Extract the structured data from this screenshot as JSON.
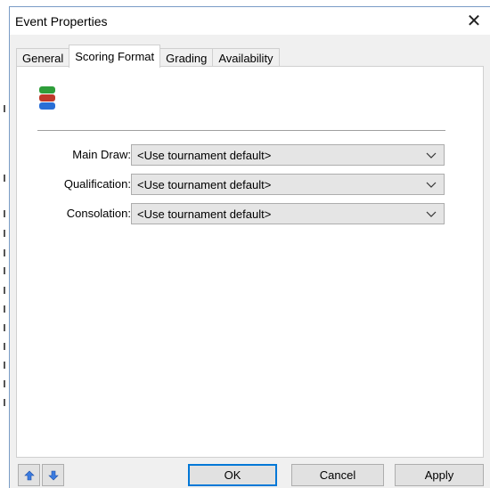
{
  "window": {
    "title": "Event Properties",
    "close_glyph": "✕"
  },
  "tabs": [
    {
      "label": "General",
      "active": false
    },
    {
      "label": "Scoring Format",
      "active": true
    },
    {
      "label": "Grading",
      "active": false
    },
    {
      "label": "Availability",
      "active": false
    }
  ],
  "panel": {
    "icon": "stack-layers-icon",
    "icon_colors": [
      "#2e9e3a",
      "#c0392b",
      "#2a6fd6"
    ],
    "fields": [
      {
        "label": "Main Draw:",
        "value": "<Use tournament default>"
      },
      {
        "label": "Qualification:",
        "value": "<Use tournament default>"
      },
      {
        "label": "Consolation:",
        "value": "<Use tournament default>"
      }
    ]
  },
  "footer": {
    "up_icon": "arrow-up-icon",
    "down_icon": "arrow-down-icon",
    "ok_label": "OK",
    "cancel_label": "Cancel",
    "apply_label": "Apply",
    "accent": "#0078d7"
  }
}
